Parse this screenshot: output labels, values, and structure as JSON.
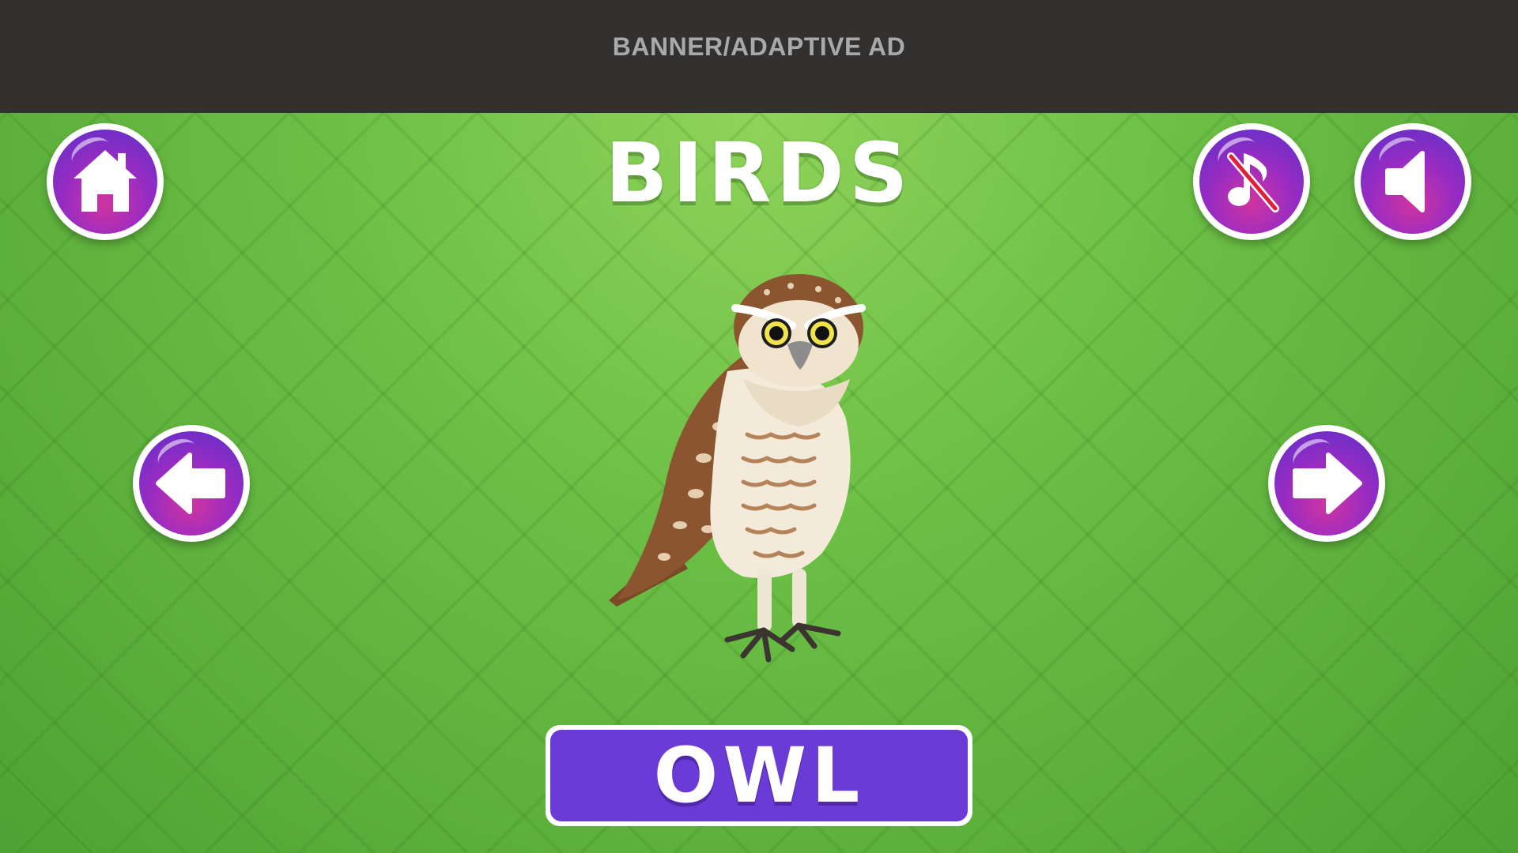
{
  "ad_banner": {
    "label": "BANNER/ADAPTIVE AD"
  },
  "header": {
    "title": "BIRDS"
  },
  "buttons": {
    "home": {
      "icon": "home-icon"
    },
    "music": {
      "icon": "music-muted-icon",
      "muted": true
    },
    "sound": {
      "icon": "speaker-icon"
    },
    "previous": {
      "icon": "arrow-left-icon"
    },
    "next": {
      "icon": "arrow-right-icon"
    }
  },
  "card": {
    "image": "owl-illustration",
    "word": "OWL"
  },
  "colors": {
    "ad_background": "#333030",
    "stage_green": "#6cbf45",
    "button_purple": "#6a3bd6",
    "button_magenta": "#d0349f"
  }
}
